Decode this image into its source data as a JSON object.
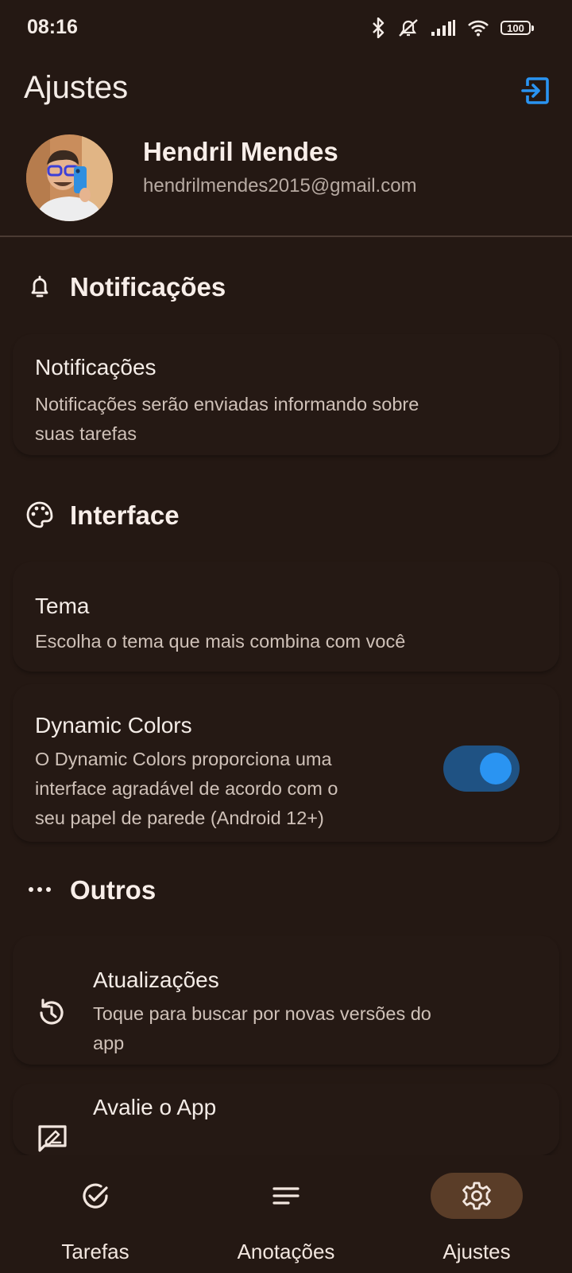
{
  "status_bar": {
    "time": "08:16",
    "battery": "100"
  },
  "header": {
    "title": "Ajustes"
  },
  "profile": {
    "name": "Hendril Mendes",
    "email": "hendrilmendes2015@gmail.com"
  },
  "sections": {
    "notifications": {
      "title": "Notificações",
      "items": [
        {
          "title": "Notificações",
          "description_line1": "Notificações serão enviadas informando sobre",
          "description_line2": "suas tarefas"
        }
      ]
    },
    "interface": {
      "title": "Interface",
      "items": [
        {
          "title": "Tema",
          "description_line1": "Escolha o tema que mais combina com você"
        },
        {
          "title": "Dynamic Colors",
          "description_line1": "O Dynamic Colors proporciona uma",
          "description_line2": "interface agradável de acordo com o",
          "description_line3": "seu papel de parede (Android 12+)",
          "enabled": true
        }
      ]
    },
    "others": {
      "title": "Outros",
      "items": [
        {
          "title": "Atualizações",
          "description_line1": "Toque para buscar por novas versões do",
          "description_line2": "app",
          "icon": "update-icon"
        },
        {
          "title": "Avalie o App",
          "icon": "rate-icon"
        }
      ]
    }
  },
  "bottom_nav": {
    "items": [
      {
        "label": "Tarefas",
        "icon": "check-circle-icon",
        "active": false
      },
      {
        "label": "Anotações",
        "icon": "notes-icon",
        "active": false
      },
      {
        "label": "Ajustes",
        "icon": "gear-icon",
        "active": true
      }
    ]
  },
  "colors": {
    "background": "#241813",
    "accent": "#2a94f2",
    "switch_track": "#1f5283",
    "nav_active_pill": "#5a3d28"
  }
}
